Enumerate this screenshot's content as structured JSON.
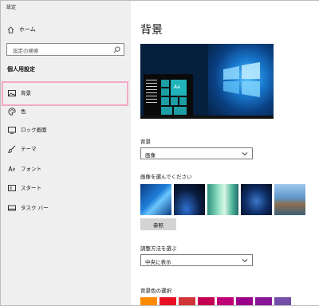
{
  "window": {
    "title": "設定"
  },
  "sidebar": {
    "home_label": "ホーム",
    "search_placeholder": "設定の検索",
    "section_title": "個人用設定",
    "items": [
      {
        "label": "背景",
        "icon": "picture-icon",
        "selected": true
      },
      {
        "label": "色",
        "icon": "palette-icon"
      },
      {
        "label": "ロック画面",
        "icon": "lock-screen-icon"
      },
      {
        "label": "テーマ",
        "icon": "brush-icon"
      },
      {
        "label": "フォント",
        "icon": "font-icon"
      },
      {
        "label": "スタート",
        "icon": "start-icon"
      },
      {
        "label": "タスク バー",
        "icon": "taskbar-icon"
      }
    ],
    "highlight_color": "#f5a7c7"
  },
  "main": {
    "title": "背景",
    "preview": {
      "tile_text": "Aa"
    },
    "background": {
      "label": "背景",
      "value": "画像"
    },
    "choose_picture": {
      "label": "画像を選んでください",
      "thumbnails": [
        "blue-light-windows",
        "dark-blue-windows",
        "green-waves",
        "deep-blue-night",
        "beach-rocks"
      ]
    },
    "browse_button": "参照",
    "fit": {
      "label": "調整方法を選ぶ",
      "value": "中央に表示"
    },
    "background_color": {
      "label": "背景色の選択",
      "swatches": [
        "#ff8c00",
        "#e81123",
        "#d13438",
        "#c30052",
        "#bf0077",
        "#9a0089",
        "#881798",
        "#744da9"
      ]
    }
  }
}
